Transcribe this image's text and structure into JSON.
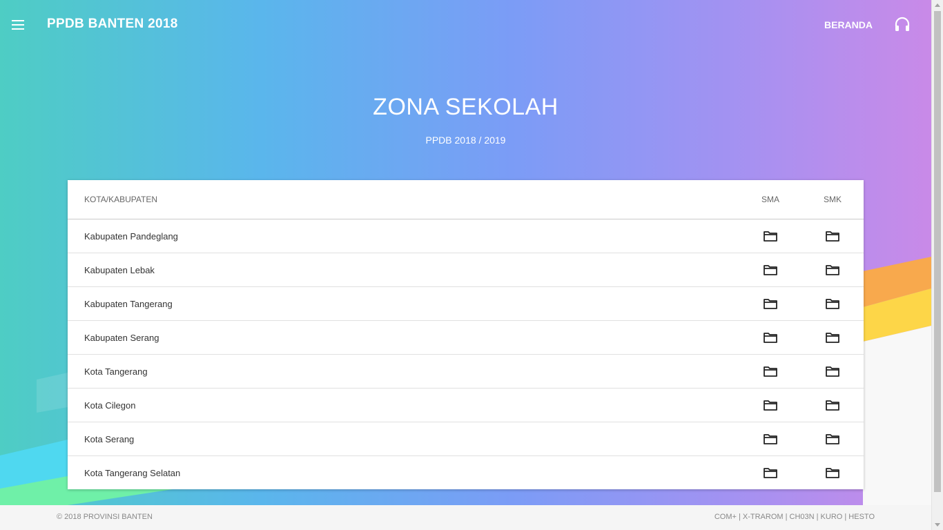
{
  "header": {
    "brand": "PPDB BANTEN 2018",
    "nav_home": "BERANDA",
    "menu_icon": "hamburger-menu-icon",
    "help_icon": "headset-icon"
  },
  "hero": {
    "title": "ZONA SEKOLAH",
    "subtitle": "PPDB 2018 / 2019"
  },
  "table": {
    "columns": {
      "city": "KOTA/KABUPATEN",
      "sma": "SMA",
      "smk": "SMK"
    },
    "folder_icon": "folder-icon",
    "rows": [
      {
        "name": "Kabupaten Pandeglang"
      },
      {
        "name": "Kabupaten Lebak"
      },
      {
        "name": "Kabupaten Tangerang"
      },
      {
        "name": "Kabupaten Serang"
      },
      {
        "name": "Kota Tangerang"
      },
      {
        "name": "Kota Cilegon"
      },
      {
        "name": "Kota Serang"
      },
      {
        "name": "Kota Tangerang Selatan"
      }
    ]
  },
  "footer": {
    "copyright": "© 2018 PROVINSI BANTEN",
    "credits": "COM+ | X-TRAROM | CH03N | KURO | HESTO"
  },
  "colors": {
    "gradient_start": "#4ecdc4",
    "gradient_mid": "#7b9cf6",
    "gradient_end": "#c98ae8",
    "accent_orange": "#fbab45",
    "accent_yellow": "#fdd648",
    "accent_cyan": "#4fd8f0",
    "accent_green": "#6ff0a8"
  }
}
